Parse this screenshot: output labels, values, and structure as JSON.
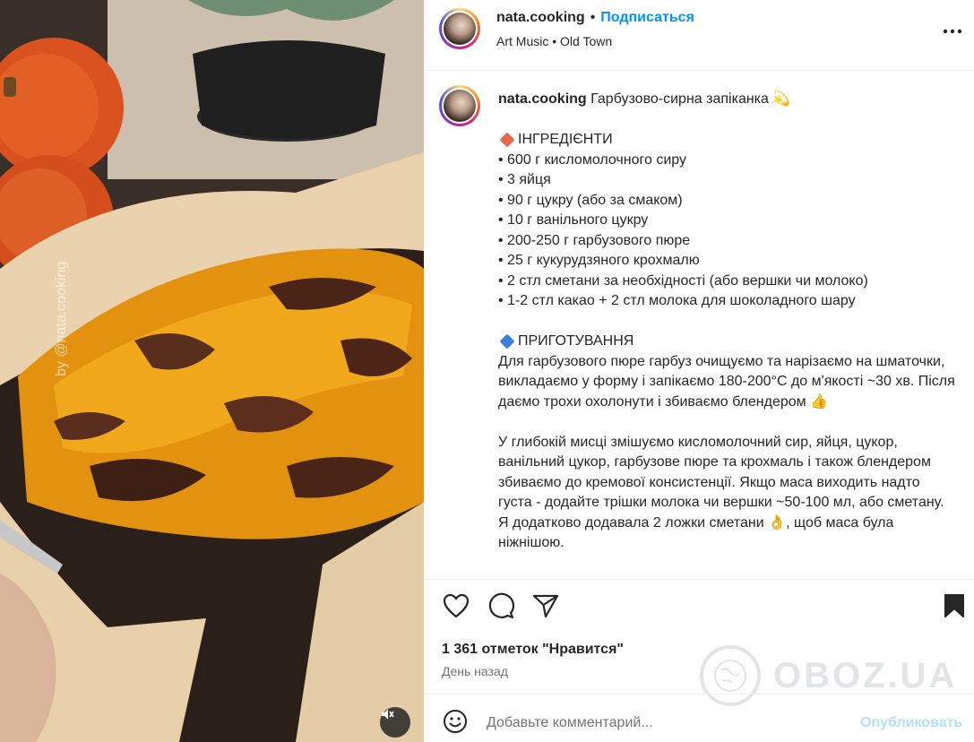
{
  "header": {
    "username": "nata.cooking",
    "separator": "•",
    "follow_label": "Подписаться",
    "location": "Art Music • Old Town",
    "more_icon": "more-horizontal-icon"
  },
  "media": {
    "watermark_text": "by @nata.cooking",
    "mute_icon": "speaker-muted-icon"
  },
  "caption": {
    "username": "nata.cooking",
    "title": "Гарбузово-сирна запіканка 💫",
    "lines": [
      "",
      "ІНГРЕДІЄНТИ",
      "• 600 г кисломолочного сиру",
      "• 3 яйця",
      "• 90 г цукру (або за смаком)",
      "• 10 г ванільного цукру",
      "• 200-250 г гарбузового пюре",
      "• 25 г кукурудзяного крохмалю",
      "• 2 стл сметани за необхідності (або вершки чи молоко)",
      "• 1-2 стл какао + 2 стл молока для шоколадного шару",
      "",
      "ПРИГОТУВАННЯ",
      "Для гарбузового пюре гарбуз очищуємо та нарізаємо на шматочки, викладаємо у форму і запікаємо 180-200°C до м'якості ~30 хв. Після даємо трохи охолонути і збиваємо блендером 👍",
      "",
      "У глибокій мисці змішуємо кисломолочний сир, яйця, цукор, ванільний цукор, гарбузове пюре та крохмаль і також блендером збиваємо до кремової консистенції. Якщо маса виходить надто густа - додайте трішки молока чи вершки ~50-100 мл, або сметану. Я додатково додавала 2 ложки сметани 👌, щоб маса була ніжнішою."
    ],
    "section_colors": {
      "ingredients": "#e8694a",
      "preparation": "#3b7ddd"
    }
  },
  "actions": {
    "like_icon": "heart-icon",
    "comment_icon": "comment-icon",
    "share_icon": "share-icon",
    "save_icon": "bookmark-icon",
    "likes_text": "1 361 отметок \"Нравится\"",
    "time_text": "День назад"
  },
  "comment": {
    "placeholder": "Добавьте комментарий...",
    "publish_label": "Опубликовать",
    "emoji_icon": "emoji-smile-icon"
  },
  "watermark": {
    "text": "OBOZ.UA"
  },
  "colors": {
    "accent": "#0095f6",
    "publish_disabled": "#b2dffc",
    "text": "#262626",
    "muted": "#737373",
    "divider": "#efefef"
  }
}
